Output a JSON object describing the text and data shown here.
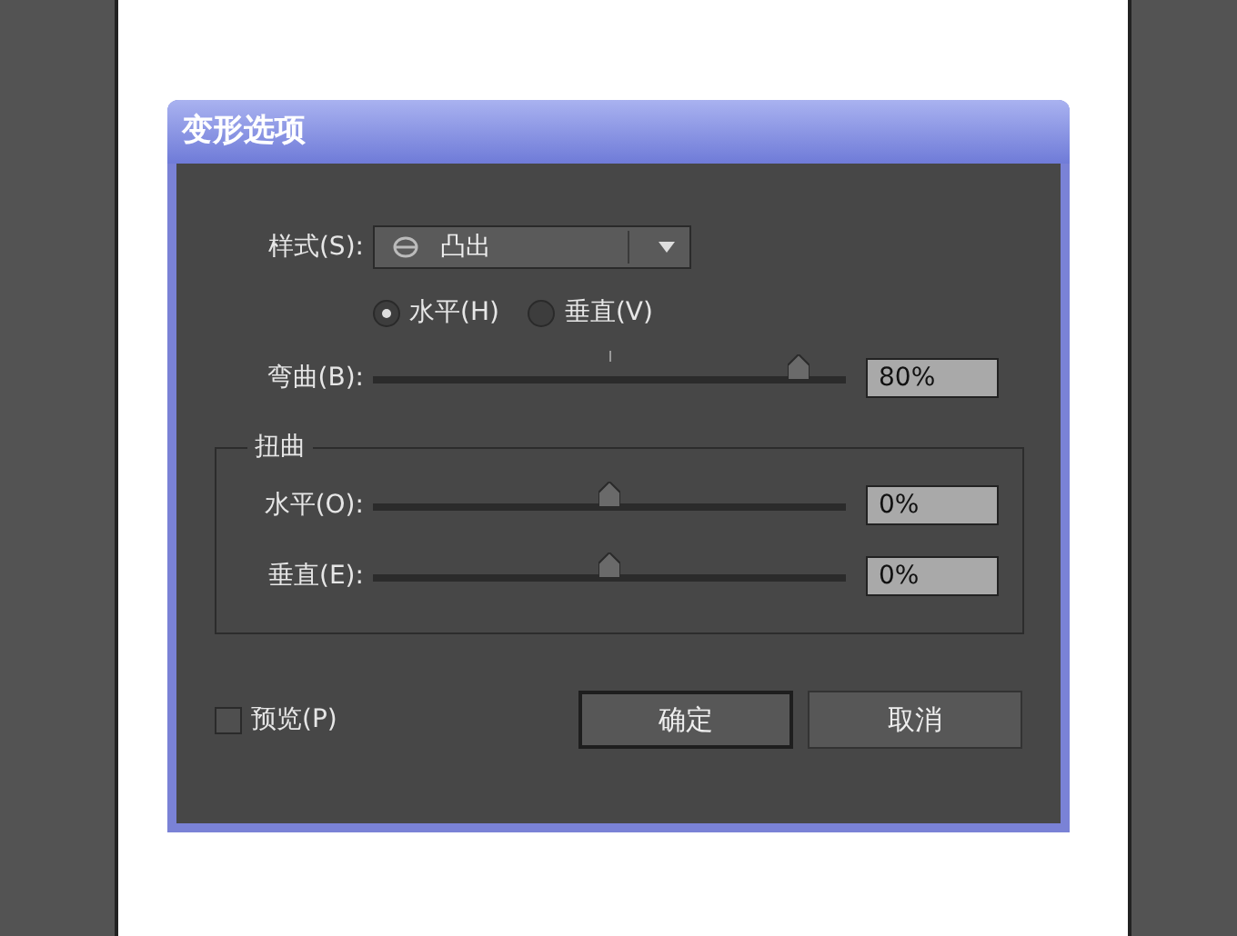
{
  "window": {
    "title": "变形选项"
  },
  "style": {
    "label": "样式(S):",
    "value": "凸出"
  },
  "orientation": [
    {
      "label": "水平(H)",
      "selected": true
    },
    {
      "label": "垂直(V)",
      "selected": false
    }
  ],
  "bend": {
    "label": "弯曲(B):",
    "level": 0.9,
    "reading": "80%"
  },
  "distortion": {
    "title": "扭曲",
    "sliders": [
      {
        "label": "水平(O):",
        "level": 0.5,
        "reading": "0%"
      },
      {
        "label": "垂直(E):",
        "level": 0.5,
        "reading": "0%"
      }
    ]
  },
  "preview": {
    "label": "预览(P)",
    "checked": false
  },
  "buttons": [
    {
      "label": "确定",
      "default": true
    },
    {
      "label": "取消",
      "default": false
    }
  ]
}
